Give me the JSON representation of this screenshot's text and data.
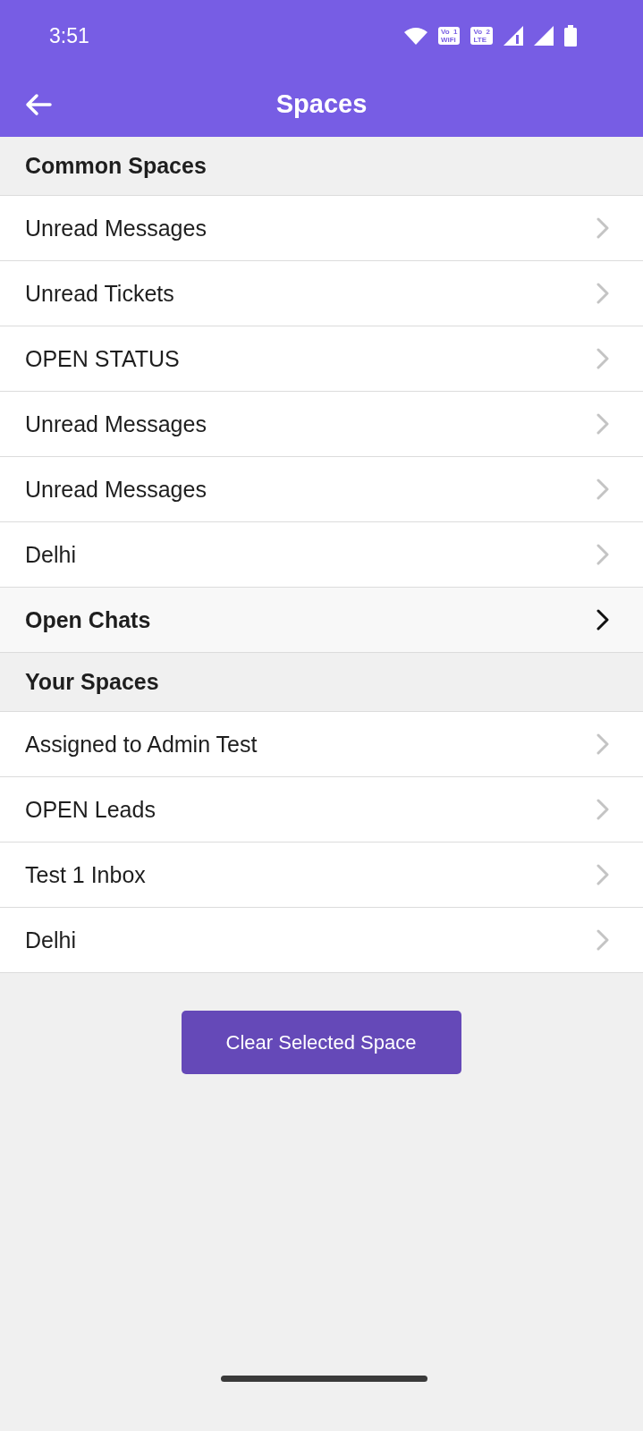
{
  "status_bar": {
    "time": "3:51",
    "volte_badges": [
      {
        "top": "Vo  1",
        "bottom": "WiFi"
      },
      {
        "top": "Vo  2",
        "bottom": "LTE"
      }
    ]
  },
  "app_bar": {
    "title": "Spaces"
  },
  "sections": [
    {
      "title": "Common Spaces",
      "items": [
        {
          "label": "Unread Messages",
          "selected": false
        },
        {
          "label": "Unread Tickets",
          "selected": false
        },
        {
          "label": "OPEN STATUS",
          "selected": false
        },
        {
          "label": "Unread Messages",
          "selected": false
        },
        {
          "label": "Unread Messages",
          "selected": false
        },
        {
          "label": "Delhi",
          "selected": false
        },
        {
          "label": "Open Chats",
          "selected": true
        }
      ]
    },
    {
      "title": "Your Spaces",
      "items": [
        {
          "label": "Assigned to Admin Test",
          "selected": false
        },
        {
          "label": "OPEN Leads",
          "selected": false
        },
        {
          "label": "Test 1 Inbox",
          "selected": false
        },
        {
          "label": "Delhi",
          "selected": false
        }
      ]
    }
  ],
  "clear_button": {
    "label": "Clear Selected Space"
  }
}
